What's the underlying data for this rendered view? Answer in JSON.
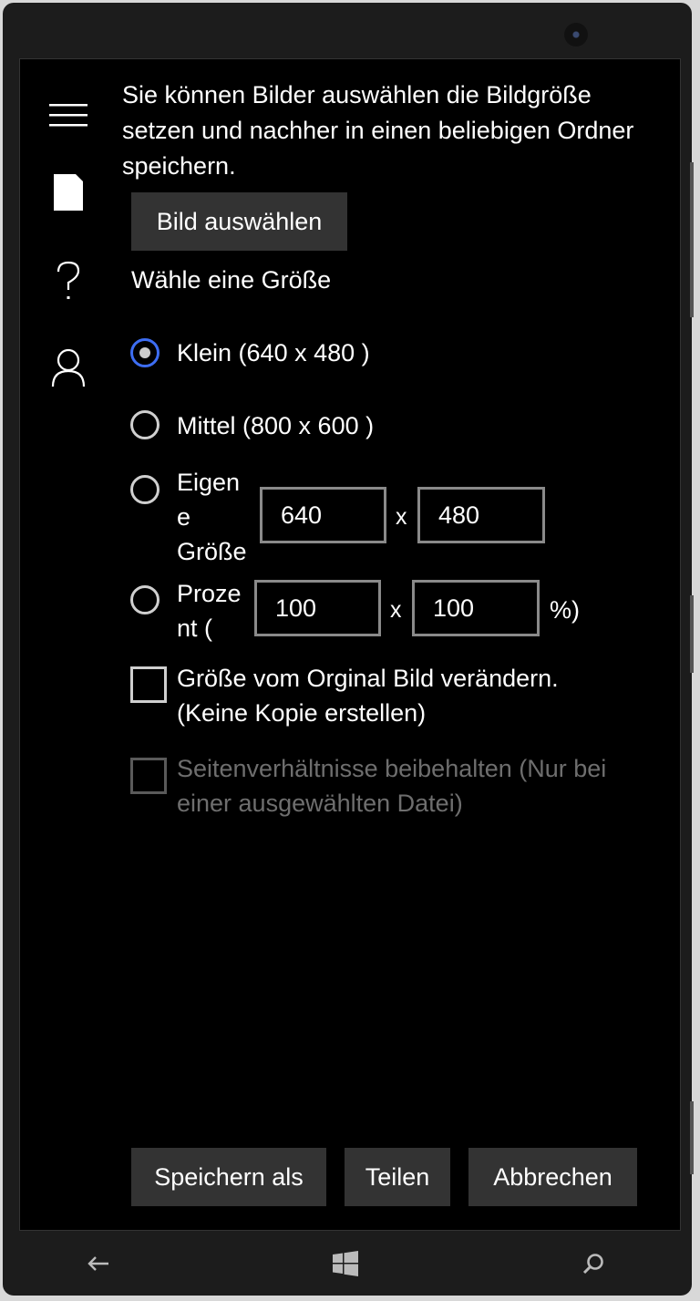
{
  "intro_text": "Sie können Bilder auswählen die Bildgröße setzen und nachher in einen beliebigen Ordner speichern.",
  "select_image_button": "Bild auswählen",
  "size_heading": "Wähle eine Größe",
  "options": {
    "small": "Klein (640 x 480 )",
    "medium": "Mittel (800 x 600 )",
    "custom_line1": "Eigen",
    "custom_line2": "e",
    "custom_line3": "Größe",
    "percent_line1": "Proze",
    "percent_line2": "nt ("
  },
  "selected_option": "small",
  "custom_width": "640",
  "custom_height": "480",
  "percent_width": "100",
  "percent_height": "100",
  "times_symbol": "x",
  "percent_suffix": "%)",
  "resize_original": {
    "line1": "Größe vom Orginal Bild verändern.",
    "line2": "(Keine Kopie erstellen)",
    "checked": false
  },
  "keep_aspect": {
    "line1": "Seitenverhältnisse beibehalten (Nur bei",
    "line2": "einer ausgewählten Datei)",
    "checked": false,
    "enabled": false
  },
  "footer": {
    "save_as": "Speichern als",
    "share": "Teilen",
    "cancel": "Abbrechen"
  },
  "icons": [
    "hamburger-menu-icon",
    "document-icon",
    "question-mark-icon",
    "user-icon",
    "back-arrow-icon",
    "windows-logo-icon",
    "search-icon"
  ],
  "colors": {
    "accent": "#3d6df2",
    "background": "#000000",
    "button": "#333333",
    "disabled": "#6e6e6e"
  }
}
